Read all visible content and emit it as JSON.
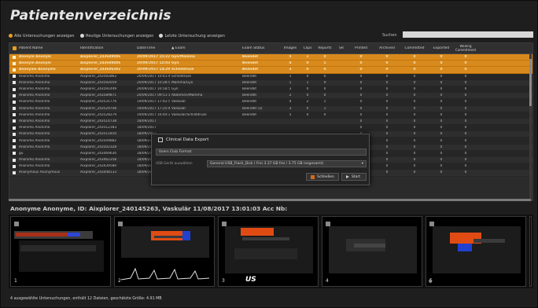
{
  "title": "Patientenverzeichnis",
  "filters": [
    {
      "label": "Alle Untersuchungen anzeigen",
      "active": true
    },
    {
      "label": "Heutige Untersuchungen anzeigen",
      "active": false
    },
    {
      "label": "Letzte Untersuchung anzeigen",
      "active": false
    }
  ],
  "search": {
    "label": "Suchen",
    "value": ""
  },
  "columns": [
    "Patient Name",
    "Identification",
    "Date/Time",
    "Exam",
    "Exam Status",
    "Images",
    "Clips",
    "Reports",
    "SR",
    "Printed",
    "Archived",
    "Committed",
    "Exported",
    "Waiting Commitment"
  ],
  "rows": [
    {
      "name": "Anonym Anonym",
      "id": "Aixplorer_243689086",
      "date": "20/09/2017 15:22:35",
      "exam": "Gyn/Mamma",
      "status": "Beendet",
      "images": "5",
      "clips": "1",
      "reports": "0",
      "sr": "",
      "printed": "0",
      "archived": "0",
      "committed": "0",
      "exported": "0",
      "waiting": "0",
      "selected": true
    },
    {
      "name": "Anonym Anonym",
      "id": "Aixplorer_243688486",
      "date": "20/09/2017 15:03:06",
      "exam": "Gyn",
      "status": "Beendet",
      "images": "4",
      "clips": "0",
      "reports": "1",
      "sr": "",
      "printed": "0",
      "archived": "0",
      "committed": "0",
      "exported": "0",
      "waiting": "0",
      "selected": true
    },
    {
      "name": "Anonyme Anonyme",
      "id": "Aixplorer_243686382",
      "date": "20/09/2017 14:29:42",
      "exam": "Schilddrüse",
      "status": "Beendet",
      "images": "3",
      "clips": "0",
      "reports": "0",
      "sr": "",
      "printed": "0",
      "archived": "0",
      "committed": "0",
      "exported": "0",
      "waiting": "0",
      "selected": true
    },
    {
      "name": "Anonimo Anonimo",
      "id": "Aixplorer_243592863",
      "date": "20/09/2017 10:41:43",
      "exam": "Schilddrüse",
      "status": "Beendet",
      "images": "1",
      "clips": "0",
      "reports": "0",
      "sr": "",
      "printed": "0",
      "archived": "0",
      "committed": "0",
      "exported": "0",
      "waiting": "0",
      "selected": false
    },
    {
      "name": "Anonimo Anonimo",
      "id": "Aixplorer_243592059",
      "date": "20/09/2017 10:28:58",
      "exam": "Mamma/Gyn",
      "status": "Beendet",
      "images": "1",
      "clips": "1",
      "reports": "0",
      "sr": "",
      "printed": "0",
      "archived": "0",
      "committed": "0",
      "exported": "0",
      "waiting": "0",
      "selected": false
    },
    {
      "name": "Anonimo Anonimo",
      "id": "Aixplorer_243591449",
      "date": "20/09/2017 10:18:54",
      "exam": "Gyn",
      "status": "Beendet",
      "images": "3",
      "clips": "0",
      "reports": "0",
      "sr": "",
      "printed": "0",
      "archived": "0",
      "committed": "0",
      "exported": "0",
      "waiting": "0",
      "selected": false
    },
    {
      "name": "Anonimo Anonimo",
      "id": "Aixplorer_243589871",
      "date": "20/09/2017 09:51:11",
      "exam": "Abdomen/Mamma",
      "status": "Beendet",
      "images": "2",
      "clips": "0",
      "reports": "0",
      "sr": "",
      "printed": "0",
      "archived": "0",
      "committed": "0",
      "exported": "0",
      "waiting": "0",
      "selected": false
    },
    {
      "name": "Anonimo Anonimo",
      "id": "Aixplorer_243531776",
      "date": "19/09/2017 17:42:54",
      "exam": "Vaskulär",
      "status": "Beendet",
      "images": "4",
      "clips": "2",
      "reports": "1",
      "sr": "",
      "printed": "0",
      "archived": "0",
      "committed": "0",
      "exported": "0",
      "waiting": "0",
      "selected": false
    },
    {
      "name": "Anonimo Anonimo",
      "id": "Aixplorer_243529748",
      "date": "19/09/2017 17:25:48",
      "exam": "Vaskulär",
      "status": "Beendet (3)",
      "images": "3",
      "clips": "0",
      "reports": "1",
      "sr": "",
      "printed": "0",
      "archived": "0",
      "committed": "0",
      "exported": "0",
      "waiting": "0",
      "selected": false
    },
    {
      "name": "Anonimo Anonimo",
      "id": "Aixplorer_243528279",
      "date": "19/09/2017 16:44:36",
      "exam": "Vaskulär/Schilddrüse",
      "status": "Beendet",
      "images": "5",
      "clips": "0",
      "reports": "0",
      "sr": "",
      "printed": "0",
      "archived": "0",
      "committed": "0",
      "exported": "0",
      "waiting": "0",
      "selected": false
    },
    {
      "name": "Anonimo Anonimo",
      "id": "Aixplorer_243514738",
      "date": "18/09/2017",
      "exam": "",
      "status": "",
      "images": "",
      "clips": "",
      "reports": "",
      "sr": "",
      "printed": "0",
      "archived": "0",
      "committed": "0",
      "exported": "0",
      "waiting": "0",
      "selected": false
    },
    {
      "name": "Anonimo Anonimo",
      "id": "Aixplorer_243512183",
      "date": "18/09/2017",
      "exam": "",
      "status": "",
      "images": "",
      "clips": "",
      "reports": "",
      "sr": "",
      "printed": "0",
      "archived": "0",
      "committed": "0",
      "exported": "0",
      "waiting": "0",
      "selected": false
    },
    {
      "name": "Anonimo Anonimo",
      "id": "Aixplorer_243511810",
      "date": "18/09/2017",
      "exam": "",
      "status": "",
      "images": "",
      "clips": "",
      "reports": "",
      "sr": "",
      "printed": "0",
      "archived": "0",
      "committed": "0",
      "exported": "0",
      "waiting": "0",
      "selected": false
    },
    {
      "name": "Anonimo Anonimo",
      "id": "Aixplorer_243509882",
      "date": "18/09/2017",
      "exam": "",
      "status": "",
      "images": "",
      "clips": "",
      "reports": "",
      "sr": "",
      "printed": "0",
      "archived": "0",
      "committed": "0",
      "exported": "0",
      "waiting": "0",
      "selected": false
    },
    {
      "name": "Anonimo Anonimo",
      "id": "Aixplorer_243502328",
      "date": "18/09/2017",
      "exam": "",
      "status": "",
      "images": "",
      "clips": "",
      "reports": "",
      "sr": "",
      "printed": "0",
      "archived": "0",
      "committed": "0",
      "exported": "0",
      "waiting": "0",
      "selected": false
    },
    {
      "name": "gu",
      "id": "Aixplorer_243469630",
      "date": "18/09/2017",
      "exam": "",
      "status": "",
      "images": "",
      "clips": "",
      "reports": "",
      "sr": "",
      "printed": "0",
      "archived": "0",
      "committed": "0",
      "exported": "0",
      "waiting": "0",
      "selected": false
    },
    {
      "name": "Anonimo Anonimo",
      "id": "Aixplorer_243462358",
      "date": "18/09/2017",
      "exam": "",
      "status": "",
      "images": "",
      "clips": "",
      "reports": "",
      "sr": "",
      "printed": "0",
      "archived": "0",
      "committed": "0",
      "exported": "0",
      "waiting": "0",
      "selected": false
    },
    {
      "name": "Anonimo Anonimo",
      "id": "Aixplorer_243439580",
      "date": "18/09/2017 15:48:56",
      "exam": "Schilddrüse",
      "status": "Beendet",
      "images": "1",
      "clips": "0",
      "reports": "0",
      "sr": "",
      "printed": "0",
      "archived": "0",
      "committed": "0",
      "exported": "0",
      "waiting": "0",
      "selected": false
    },
    {
      "name": "Anonymous Anonymous",
      "id": "Aixplorer_243448133",
      "date": "18/09/2017 15:37:46",
      "exam": "Abdomen/Gyn",
      "status": "Beendet (3)",
      "images": "2",
      "clips": "0",
      "reports": "0",
      "sr": "",
      "printed": "0",
      "archived": "0",
      "committed": "0",
      "exported": "0",
      "waiting": "0",
      "selected": false
    }
  ],
  "dialog": {
    "title": "Clinical Data Export",
    "format": "Users Club Format",
    "usb_label": "USB Gerät auswählen",
    "usb_device": "General USB_Flash_Disk ( Frei 3.37 GB frei / 3.75 GB insgesamt)",
    "close_label": "Schließen",
    "start_label": "Start"
  },
  "study_label": "Anonyme Anonyme, ID: Aixplorer_240145263, Vaskulär 11/08/2017 13:01:03 Acc Nb:",
  "thumbnails": [
    "1",
    "2",
    "3",
    "4",
    "5",
    "6"
  ],
  "status_text": "4 ausgewählte Untersuchungen, enthält 12 Dateien, geschätzte Größe: 4.91 MB",
  "colors": {
    "selection": "#d98a1c",
    "accent": "#e8a020",
    "background": "#1e1e1e"
  }
}
